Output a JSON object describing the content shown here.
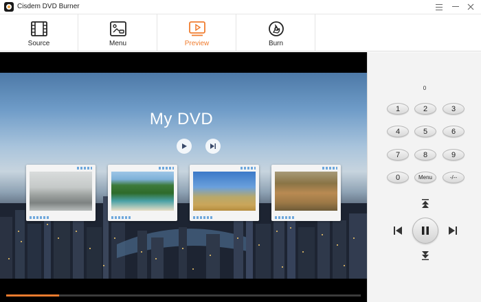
{
  "app": {
    "title": "Cisdem DVD Burner",
    "logo": "dvd-disc-logo"
  },
  "window_controls": {
    "menu_icon": "hamburger-icon",
    "minimize_icon": "minimize-icon",
    "close_icon": "close-icon"
  },
  "toolbar": {
    "tabs": [
      {
        "label": "Source",
        "icon": "film-strip-icon",
        "active": false
      },
      {
        "label": "Menu",
        "icon": "menu-layout-icon",
        "active": false
      },
      {
        "label": "Preview",
        "icon": "preview-play-icon",
        "active": true
      },
      {
        "label": "Burn",
        "icon": "disc-burn-icon",
        "active": false
      }
    ],
    "active_color": "#f07c2e"
  },
  "preview": {
    "menu_title": "My DVD",
    "play_all_icon": "play-icon",
    "next_icon": "skip-next-icon",
    "thumbnails": [
      {
        "subject": "birds-over-water"
      },
      {
        "subject": "tropical-coast"
      },
      {
        "subject": "giraffes-savanna"
      },
      {
        "subject": "antelope-herd"
      }
    ],
    "progress_fraction": 0.15,
    "progress_color": "#f07c2e"
  },
  "remote": {
    "chapter_display": "0",
    "keys": [
      [
        "1",
        "2",
        "3"
      ],
      [
        "4",
        "5",
        "6"
      ],
      [
        "7",
        "8",
        "9"
      ],
      [
        "0",
        "Menu",
        "-/--"
      ]
    ],
    "controls": {
      "up_icon": "skip-up-icon",
      "down_icon": "skip-down-icon",
      "previous_icon": "previous-chapter-icon",
      "next_icon": "next-chapter-icon",
      "pause_icon": "pause-icon"
    }
  }
}
